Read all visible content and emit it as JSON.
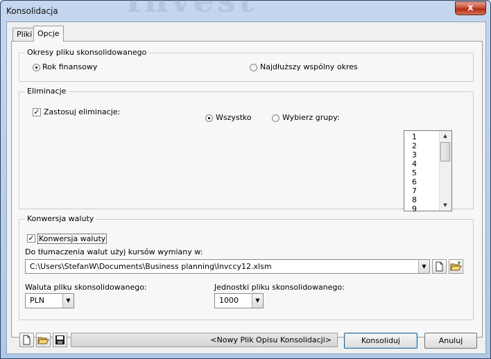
{
  "window": {
    "title": "Konsolidacja",
    "close_label": "x",
    "watermark": "Invest"
  },
  "tabs": [
    {
      "label": "Pliki"
    },
    {
      "label": "Opcje"
    }
  ],
  "periods": {
    "legend": "Okresy pliku skonsolidowanego",
    "option1": "Rok finansowy",
    "option2": "Najdłuższy wspólny okres",
    "selected": "option1"
  },
  "elimination": {
    "legend": "Eliminacje",
    "apply_label": "Zastosuj eliminacje:",
    "apply_checked": true,
    "all_label": "Wszystko",
    "select_groups_label": "Wybierz grupy:",
    "selected": "all",
    "groups": [
      "1",
      "2",
      "3",
      "4",
      "5",
      "6",
      "7",
      "8",
      "9"
    ]
  },
  "currency": {
    "legend": "Konwersja waluty",
    "convert_label": "Konwersja waluty",
    "convert_checked": true,
    "rates_label": "Do tłumaczenia walut użyj kursów wymiany w:",
    "rates_file": "C:\\Users\\StefanW\\Documents\\Business planning\\Invccy12.xlsm",
    "currency_label": "Waluta pliku skonsolidowanego:",
    "currency_value": "PLN",
    "units_label": "Jednostki pliku skonsolidowanego:",
    "units_value": "1000"
  },
  "footer": {
    "status": "<Nowy Plik Opisu Konsolidacji>",
    "consolidate_label": "Konsoliduj",
    "cancel_label": "Anuluj"
  },
  "icons": {
    "new": "new-file-icon",
    "open": "open-folder-icon",
    "save": "save-disk-icon",
    "dropdown": "chevron-down-icon"
  }
}
